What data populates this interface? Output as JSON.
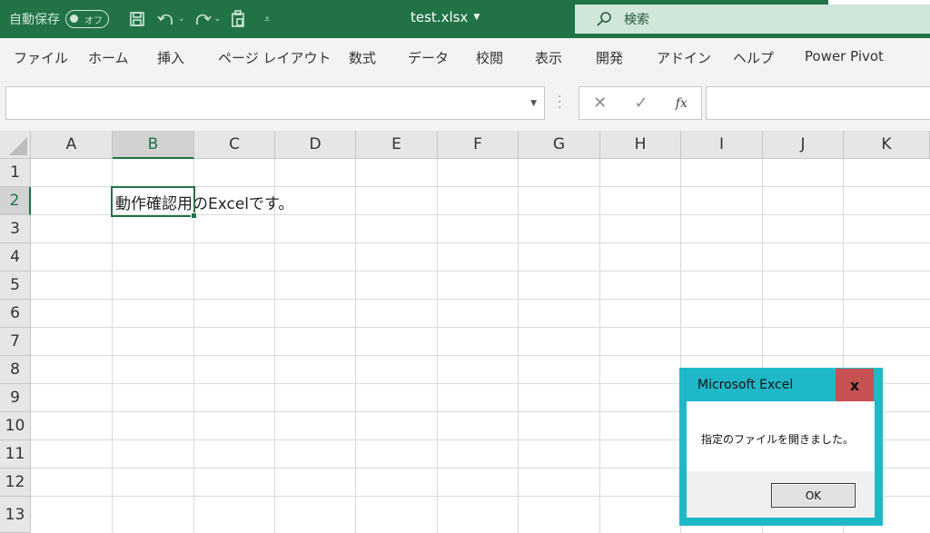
{
  "titlebar": {
    "autosave_label": "自動保存",
    "autosave_state": "オフ",
    "file_name": "test.xlsx",
    "search_placeholder": "検索",
    "icons": [
      "save-icon",
      "undo-icon",
      "redo-icon",
      "paste-icon",
      "customize-qat-icon",
      "search-icon"
    ]
  },
  "ribbon": {
    "tabs": [
      "ファイル",
      "ホーム",
      "挿入",
      "ページ レイアウト",
      "数式",
      "データ",
      "校閲",
      "表示",
      "開発",
      "アドイン",
      "ヘルプ",
      "Power Pivot"
    ]
  },
  "formula_bar": {
    "name_box": "",
    "fx_label": "fx",
    "cancel_symbol": "✕",
    "enter_symbol": "✓",
    "formula": ""
  },
  "sheet": {
    "columns": [
      "A",
      "B",
      "C",
      "D",
      "E",
      "F",
      "G",
      "H",
      "I",
      "J",
      "K"
    ],
    "rows": [
      "1",
      "2",
      "3",
      "4",
      "5",
      "6",
      "7",
      "8",
      "9",
      "10",
      "11",
      "12",
      "13"
    ],
    "selected_column": "B",
    "selected_row": "2",
    "cell_b2": "動作確認用のExcelです。"
  },
  "dialog": {
    "title": "Microsoft Excel",
    "close_label": "x",
    "message": "指定のファイルを開きました。",
    "ok_label": "OK",
    "accent_color": "#1fb8c9",
    "close_color": "#c75050"
  },
  "colors": {
    "excel_green": "#217346"
  }
}
